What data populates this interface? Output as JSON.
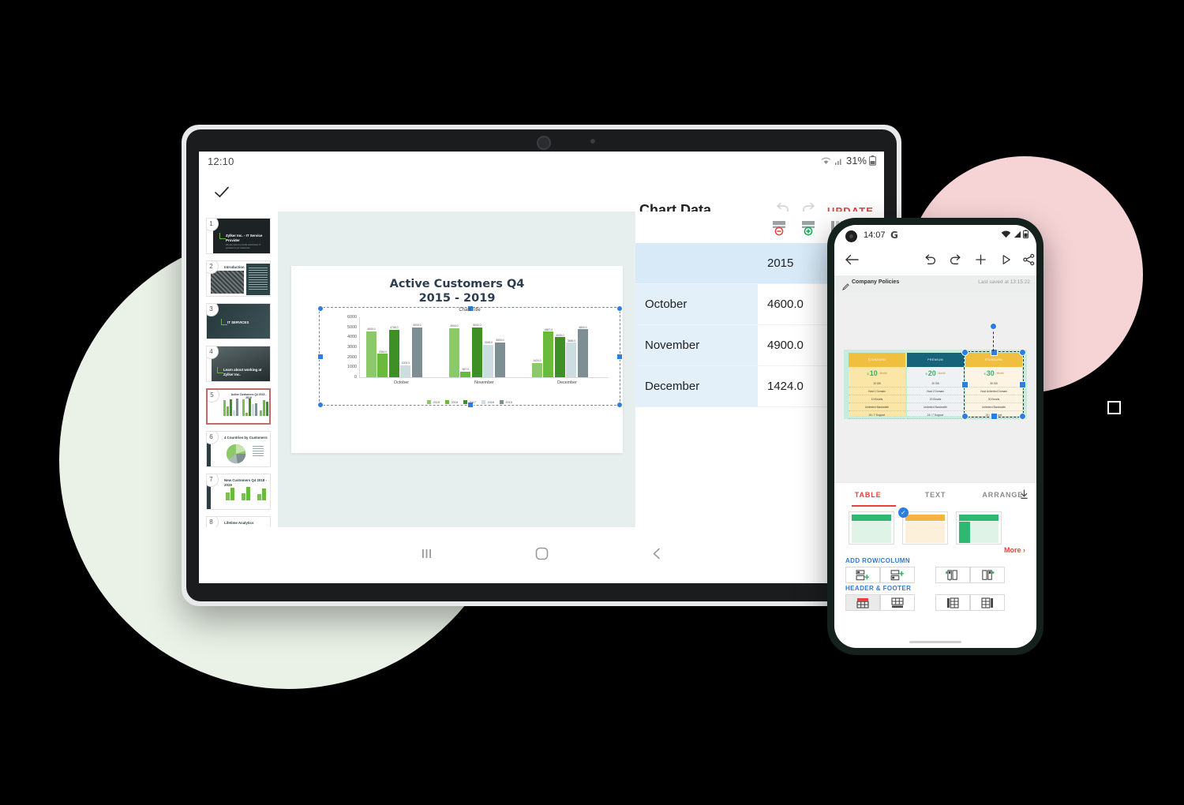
{
  "tablet": {
    "status": {
      "time": "12:10",
      "battery": "31%",
      "wifi_icon": "wifi-icon",
      "signal_icon": "signal-icon",
      "battery_icon": "battery-icon"
    },
    "toolbar": {
      "confirm_icon": "check-icon",
      "panel_title": "Chart Data",
      "undo_icon": "undo-icon",
      "redo_icon": "redo-icon",
      "update_label": "UPDATE"
    },
    "slides": [
      {
        "number": "1",
        "title": "Zylker Inc. - IT Service Provider",
        "subtitle": "We are here to provide world class IT services to our customers"
      },
      {
        "number": "2",
        "title": "Introduction"
      },
      {
        "number": "3",
        "title": "IT SERVICES"
      },
      {
        "number": "4",
        "title": "Learn about working at Zylker Inc."
      },
      {
        "number": "5",
        "title": "Active Customers Q4 2015 - 2019"
      },
      {
        "number": "6",
        "title": "4 Countries by Customers"
      },
      {
        "number": "7",
        "title": "New Customers Q4 2018 - 2019"
      },
      {
        "number": "8",
        "title": "Lifetime Analytics"
      }
    ],
    "add_slide": {
      "icon": "add-slide-icon",
      "plus": "+"
    },
    "slide_canvas": {
      "title_line1": "Active Customers Q4",
      "title_line2": "2015 - 2019"
    },
    "data_panel": {
      "remove_row_icon": "delete-row-icon",
      "add_row_icon": "insert-row-icon",
      "columns_icon": "columns-icon",
      "rows": [
        {
          "label": "",
          "value": "2015",
          "header": true
        },
        {
          "label": "October",
          "value": "4600.0",
          "header": false
        },
        {
          "label": "November",
          "value": "4900.0",
          "header": false
        },
        {
          "label": "December",
          "value": "1424.0",
          "header": false
        }
      ]
    },
    "navbar": {
      "recents_icon": "recents-icon",
      "home_icon": "home-icon",
      "back_icon": "back-icon"
    }
  },
  "chart_data": {
    "type": "bar",
    "title": "Chart Title",
    "slide_title": "Active Customers Q4 2015 - 2019",
    "categories": [
      "October",
      "November",
      "December"
    ],
    "series": [
      {
        "name": "2015",
        "color": "#8cc96a",
        "values": [
          4600.0,
          4900.0,
          1424.0
        ]
      },
      {
        "name": "2016",
        "color": "#6aba3c",
        "values": [
          2344.0,
          567.0,
          4567.0
        ]
      },
      {
        "name": "2017",
        "color": "#3f8f27",
        "values": [
          4766.0,
          5002.0,
          4000.0
        ]
      },
      {
        "name": "2018",
        "color": "#ccdce0",
        "values": [
          1200.0,
          3245.0,
          3456.0
        ]
      },
      {
        "name": "2019",
        "color": "#7e8f94",
        "values": [
          5000.0,
          3500.0,
          4800.0
        ]
      }
    ],
    "value_labels": [
      [
        "4600.0",
        "2344.0",
        "4766.0",
        "1200.0",
        "5000.0"
      ],
      [
        "4900.0",
        "567.0",
        "5002.0",
        "3245.0",
        "3500.0"
      ],
      [
        "1424.0",
        "4567.0",
        "4000.0",
        "3456.0",
        "4800.0"
      ]
    ],
    "yticks": [
      "6000",
      "5000",
      "4000",
      "3000",
      "2000",
      "1000",
      "0"
    ],
    "ylim": [
      0,
      6000
    ],
    "xlabel": "",
    "ylabel": "",
    "grid": false,
    "legend_position": "bottom"
  },
  "phone": {
    "status": {
      "time": "14:07",
      "google_glyph": "G",
      "wifi_icon": "wifi-icon",
      "signal_icon": "signal-icon",
      "battery_icon": "battery-icon"
    },
    "toolbar": {
      "back_icon": "back-arrow-icon",
      "undo_icon": "undo-icon",
      "redo_icon": "redo-icon",
      "add_icon": "plus-icon",
      "present_icon": "play-icon",
      "share_icon": "share-icon"
    },
    "subbar": {
      "edit_icon": "pencil-icon",
      "doc_name": "Company Policies",
      "saved_text": "Last saved at 13:15:22"
    },
    "pricing": {
      "columns": [
        {
          "plan": "STANDARD",
          "currency": "$",
          "amount": "10",
          "period": "- Month",
          "rows": [
            "10 GB",
            "Host 1 Domain",
            "10 Emails",
            "Unlimited Bandwidth",
            "24 / 7 Support"
          ]
        },
        {
          "plan": "PREMIUM",
          "currency": "$",
          "amount": "20",
          "period": "- Month",
          "rows": [
            "20 GB",
            "Host 2 Domain",
            "20 Emails",
            "Unlimited Bandwidth",
            "24 / 7 Support"
          ]
        },
        {
          "plan": "STANDARD",
          "currency": "$",
          "amount": "30",
          "period": "- Month",
          "rows": [
            "30 GB",
            "Host Unlimited Domain",
            "30 Emails",
            "Unlimited Bandwidth",
            "24 / 7 Support"
          ]
        }
      ]
    },
    "tabs": [
      {
        "label": "TABLE",
        "active": true
      },
      {
        "label": "TEXT",
        "active": false
      },
      {
        "label": "ARRANGE",
        "active": false
      }
    ],
    "collapse_icon": "collapse-down-icon",
    "styles": {
      "items": [
        {
          "name": "table-style-green",
          "selected": false
        },
        {
          "name": "table-style-orange",
          "selected": true
        },
        {
          "name": "table-style-green-banded",
          "selected": false
        }
      ],
      "more_label": "More",
      "more_icon": "chevron-right-icon"
    },
    "sections": [
      {
        "title": "ADD ROW/COLUMN",
        "buttons": [
          "insert-row-above-icon",
          "insert-row-below-icon",
          "insert-column-left-icon",
          "insert-column-right-icon"
        ]
      },
      {
        "title": "HEADER & FOOTER",
        "buttons": [
          "header-row-icon",
          "footer-row-icon",
          "header-column-icon",
          "footer-column-icon"
        ]
      }
    ]
  },
  "decor": {
    "square_icon": "square-icon"
  },
  "colors": {
    "accent_red": "#e8413c",
    "blue_link": "#2f7ad6",
    "selection_blue": "#2a7fe0",
    "table_blue": "#e3f0fa",
    "canvas_green": "#e6efee",
    "blob_green": "#eaf2e8",
    "blob_pink": "#f6d4d6"
  }
}
